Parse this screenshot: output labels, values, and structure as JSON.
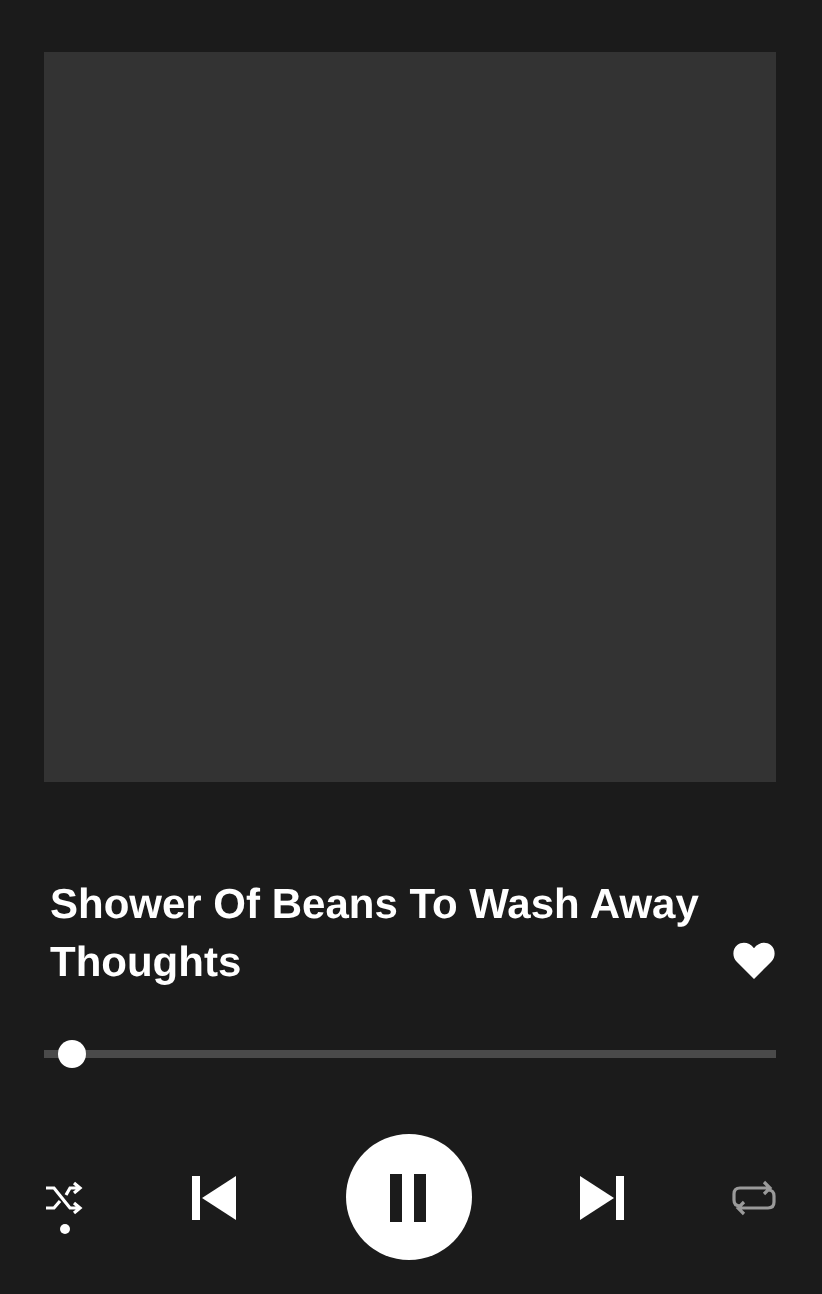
{
  "track": {
    "title": "Shower Of Beans To Wash Away Thoughts",
    "liked": true
  },
  "progress": {
    "level": 0.02
  },
  "controls": {
    "shuffle": true,
    "playing": true,
    "repeat": false
  }
}
